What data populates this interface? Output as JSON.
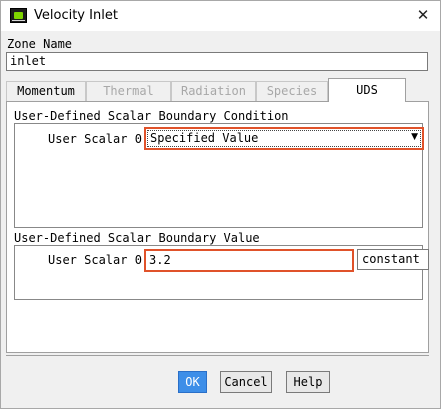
{
  "window": {
    "title": "Velocity Inlet",
    "close_glyph": "✕"
  },
  "zone": {
    "label": "Zone Name",
    "value": "inlet"
  },
  "tabs": [
    {
      "label": "Momentum",
      "state": "enabled"
    },
    {
      "label": "Thermal",
      "state": "disabled"
    },
    {
      "label": "Radiation",
      "state": "disabled"
    },
    {
      "label": "Species",
      "state": "disabled"
    },
    {
      "label": "UDS",
      "state": "active"
    }
  ],
  "boundary_condition": {
    "title": "User-Defined Scalar Boundary Condition",
    "row_label": "User Scalar 0",
    "selected": "Specified Value",
    "arrow_icon": "chevron-down-icon"
  },
  "boundary_value": {
    "title": "User-Defined Scalar Boundary Value",
    "row_label": "User Scalar 0",
    "value": "3.2",
    "method": "constant"
  },
  "buttons": {
    "ok": "OK",
    "cancel": "Cancel",
    "help": "Help"
  },
  "colors": {
    "highlight": "#e0522a",
    "primary_button": "#3d8ee8"
  }
}
